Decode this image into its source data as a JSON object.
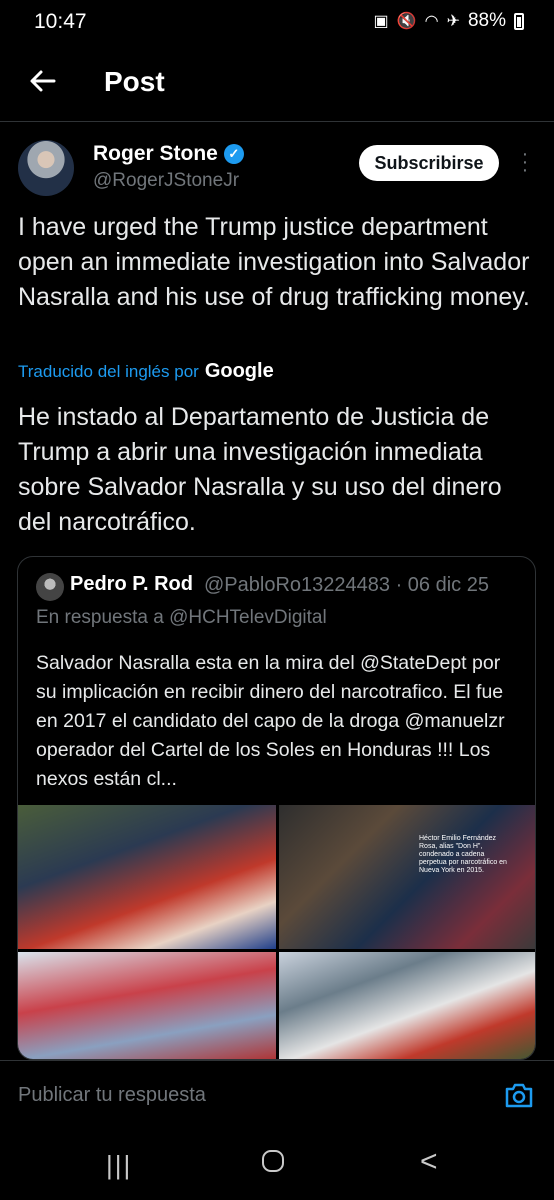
{
  "status_bar": {
    "time": "10:47",
    "battery": "88%",
    "icons": [
      "nfc-icon",
      "mute-icon",
      "wifi-icon",
      "airplane-icon",
      "battery-icon"
    ]
  },
  "header": {
    "title": "Post",
    "back_icon": "arrow-left-icon"
  },
  "post": {
    "author_name": "Roger Stone",
    "author_handle": "@RogerJStoneJr",
    "verified": true,
    "subscribe_label": "Subscribirse",
    "more_icon": "more-vertical-icon",
    "text": "I have urged the Trump justice department open an immediate investigation into Salvador Nasralla and his use of drug trafficking money.",
    "translated_label": "Traducido del inglés por",
    "translator_brand": "Google",
    "translation": "He instado al Departamento de Justicia de Trump a abrir una investigación inmediata sobre Salvador Nasralla y su uso del dinero del narcotráfico."
  },
  "quote": {
    "author_name": "Pedro P. Rod",
    "meta": "@PabloRo13224483 · 06 dic 25",
    "reply_to": "En respuesta a @HCHTelevDigital",
    "text": "Salvador Nasralla esta en la mira del @StateDept por su implicación en recibir dinero del narcotrafico. El fue en 2017  el candidato del capo de la droga @manuelzr operador del Cartel de los Soles en Honduras !!! Los nexos están cl...",
    "media_caption": "Héctor Emilio Fernández Rosa, alias \"Don H\", condenado a cadena perpetua por narcotráfico en Nueva York en 2015."
  },
  "reply_bar": {
    "placeholder": "Publicar tu respuesta",
    "camera_icon": "camera-icon"
  },
  "nav_bar": {
    "recent_label": "|||",
    "back_label": "<"
  },
  "colors": {
    "accent": "#1d9bf0",
    "background": "#000000",
    "text": "#e7e9ea",
    "muted": "#71767b",
    "divider": "#2f3336"
  }
}
